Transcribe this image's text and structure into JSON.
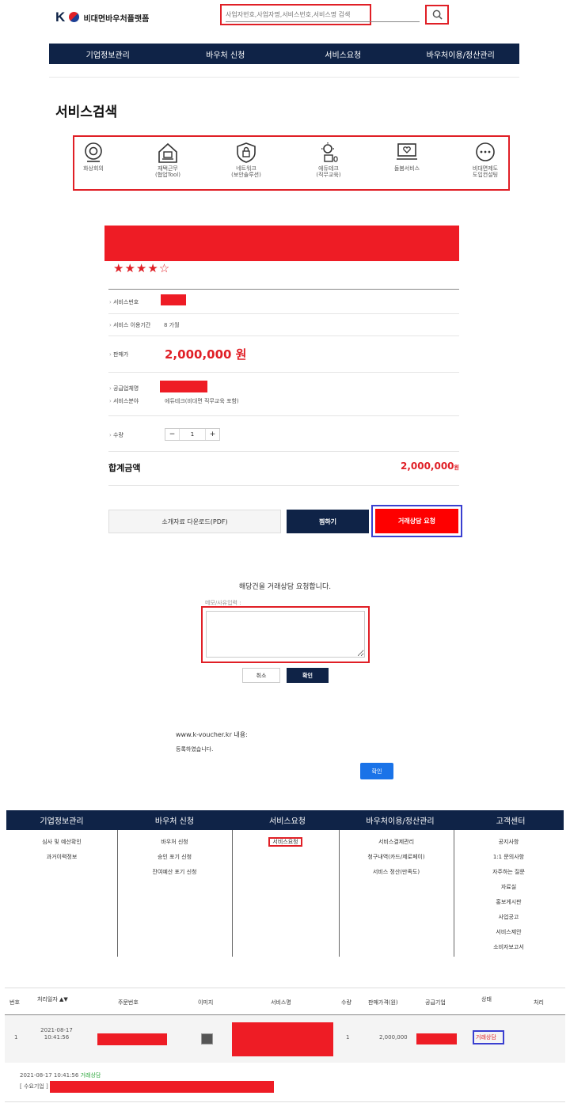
{
  "header": {
    "logo_mark": "K",
    "logo_text": "비대면바우처플랫폼",
    "search_placeholder": "사업자번호,사업자명,서비스번호,서비스명 검색"
  },
  "top_nav": [
    "기업정보관리",
    "바우처 신청",
    "서비스요청",
    "바우처이용/정산관리"
  ],
  "page_title": "서비스검색",
  "categories": [
    {
      "label": "화상회의"
    },
    {
      "label": "재택근무\n(협업Tool)"
    },
    {
      "label": "네트워크\n(보안솔루션)"
    },
    {
      "label": "에듀테크\n(직무교육)"
    },
    {
      "label": "돌봄서비스"
    },
    {
      "label": "비대면제도\n도입컨설팅"
    }
  ],
  "product": {
    "stars": "★★★★☆",
    "service_no_label": "서비스번호",
    "period_label": "서비스 이용기간",
    "period_value": "8 가월",
    "price_label": "판매가",
    "price_value": "2,000,000 원",
    "supplier_label": "공급업체명",
    "field_label": "서비스분야",
    "field_value": "에듀테크(비대면 직무교육 포함)",
    "qty_label": "수량",
    "qty_minus": "−",
    "qty_value": "1",
    "qty_plus": "+",
    "total_label": "합계금액",
    "total_value": "2,000,000",
    "total_unit": "원",
    "btn_download": "소개자료 다운로드(PDF)",
    "btn_wish": "찜하기",
    "btn_request": "거래상담 요청"
  },
  "dialog": {
    "title": "해당건을 거래상담 요청합니다.",
    "memo_label": "메모/사유입력 :",
    "cancel": "취소",
    "confirm": "확인"
  },
  "alert": {
    "site": "www.k-voucher.kr 내용:",
    "message": "등록하였습니다.",
    "ok": "확인"
  },
  "mega_nav": [
    "기업정보관리",
    "바우처 신청",
    "서비스요청",
    "바우처이용/정산관리",
    "고객센터"
  ],
  "mega_menu": {
    "col1": [
      "심사 및 예산확인",
      "과거이력정보"
    ],
    "col2": [
      "바우처 신청",
      "승인 포기 신청",
      "잔여예산 포기 신청"
    ],
    "col3": [
      "서비스요청"
    ],
    "col4": [
      "서비스결제관리",
      "청구내역(카드/제로페이)",
      "서비스 정산(만족도)"
    ],
    "col5": [
      "공지사항",
      "1:1 문의사항",
      "자주하는 질문",
      "자료실",
      "홍보게시판",
      "사업공고",
      "서비스제안",
      "소비자보고서"
    ]
  },
  "table": {
    "headers": [
      "번호",
      "처리일자 ▲▼",
      "주문번호",
      "이미지",
      "서비스명",
      "수량",
      "판매가격(원)",
      "공급기업",
      "상태",
      "처리"
    ],
    "row": {
      "no": "1",
      "date": "2021-08-17\n10:41:56",
      "qty": "1",
      "price": "2,000,000",
      "status": "거래상담"
    },
    "history_date": "2021-08-17 10:41:56",
    "history_status": "거래상담",
    "history_party": "[ 수요기업 ]"
  },
  "colors": {
    "navy": "#0f2347",
    "red": "#ee1c25",
    "blue_btn": "#1a73e8",
    "annot_red": "#e01f26",
    "annot_blue": "#3a3fd0"
  }
}
